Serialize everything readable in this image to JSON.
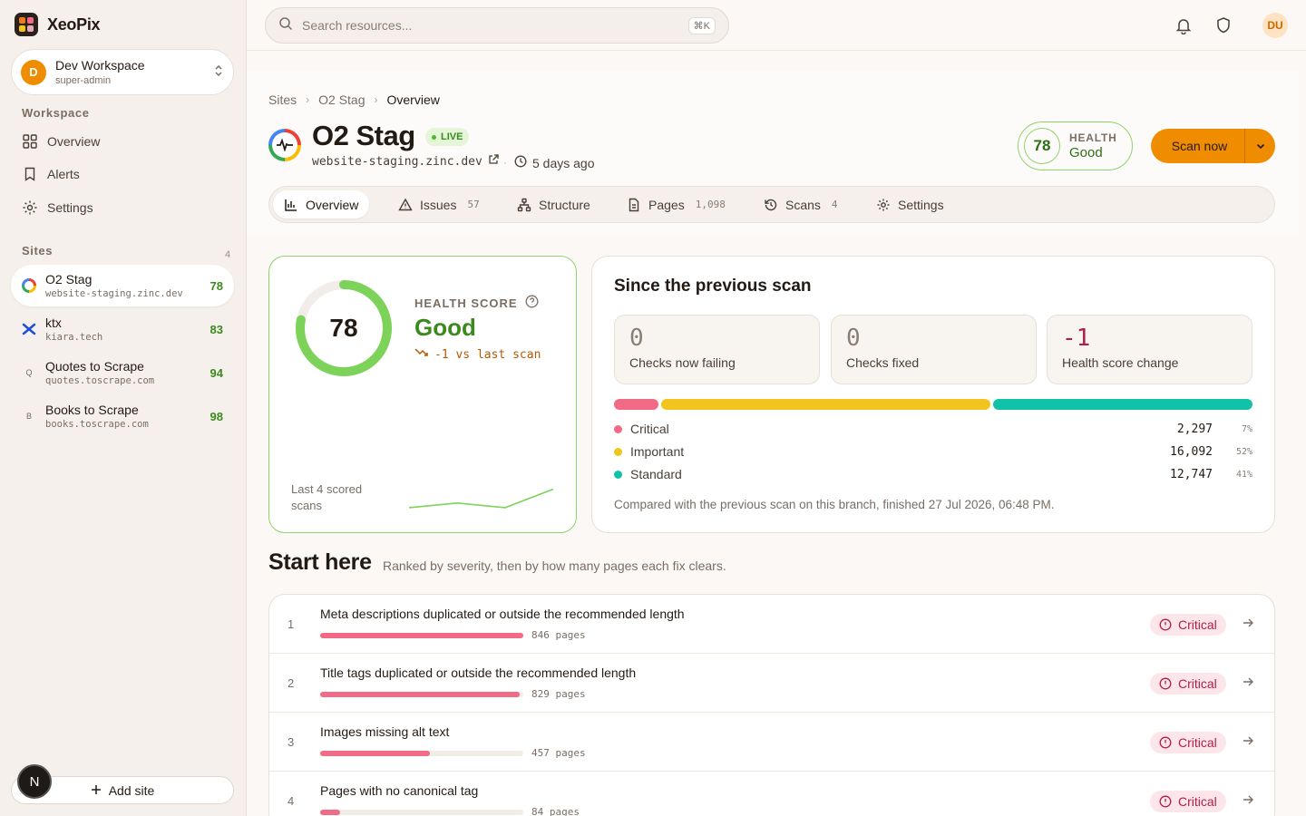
{
  "app": {
    "name": "XeoPix"
  },
  "workspace": {
    "initial": "D",
    "name": "Dev Workspace",
    "role": "super-admin"
  },
  "sidebar": {
    "workspace_title": "Workspace",
    "nav": [
      {
        "label": "Overview"
      },
      {
        "label": "Alerts"
      },
      {
        "label": "Settings"
      }
    ],
    "sites_title": "Sites",
    "sites_count": "4",
    "sites": [
      {
        "name": "O2 Stag",
        "host": "website-staging.zinc.dev",
        "score": "78"
      },
      {
        "name": "ktx",
        "host": "kiara.tech",
        "score": "83"
      },
      {
        "name": "Quotes to Scrape",
        "host": "quotes.toscrape.com",
        "score": "94",
        "initial": "Q"
      },
      {
        "name": "Books to Scrape",
        "host": "books.toscrape.com",
        "score": "98",
        "initial": "B"
      }
    ],
    "add_site": "Add site",
    "badge": "N"
  },
  "topbar": {
    "search_placeholder": "Search resources...",
    "shortcut": "⌘K",
    "user_initials": "DU"
  },
  "breadcrumb": {
    "items": [
      "Sites",
      "O2 Stag",
      "Overview"
    ]
  },
  "site": {
    "title": "O2 Stag",
    "status": "LIVE",
    "url": "website-staging.zinc.dev",
    "last_scan": "5 days ago",
    "health": {
      "score": "78",
      "label": "HEALTH",
      "value": "Good"
    }
  },
  "actions": {
    "scan_now": "Scan now"
  },
  "tabs": [
    {
      "label": "Overview"
    },
    {
      "label": "Issues",
      "count": "57"
    },
    {
      "label": "Structure"
    },
    {
      "label": "Pages",
      "count": "1,098"
    },
    {
      "label": "Scans",
      "count": "4"
    },
    {
      "label": "Settings"
    }
  ],
  "health_card": {
    "label": "HEALTH SCORE",
    "score": "78",
    "score_fraction": 0.78,
    "grade": "Good",
    "delta": "-1 vs last scan",
    "spark_label": "Last 4 scored scans",
    "spark_values": [
      78,
      79,
      78,
      82
    ]
  },
  "since": {
    "title": "Since the previous scan",
    "stats": [
      {
        "value": "0",
        "label": "Checks now failing"
      },
      {
        "value": "0",
        "label": "Checks fixed"
      },
      {
        "value": "-1",
        "label": "Health score change"
      }
    ],
    "breakdown": [
      {
        "name": "Critical",
        "count": "2,297",
        "pct": "7%",
        "color": "#f26b86",
        "share": 7
      },
      {
        "name": "Important",
        "count": "16,092",
        "pct": "52%",
        "color": "#f2c41f",
        "share": 52
      },
      {
        "name": "Standard",
        "count": "12,747",
        "pct": "41%",
        "color": "#12c2a8",
        "share": 41
      }
    ],
    "footnote": "Compared with the previous scan on this branch, finished 27 Jul 2026, 06:48 PM."
  },
  "start": {
    "title": "Start here",
    "subtitle": "Ranked by severity, then by how many pages each fix clears.",
    "issues": [
      {
        "rank": "1",
        "title": "Meta descriptions duplicated or outside the recommended length",
        "pages": "846 pages",
        "severity": "Critical",
        "fraction": 1.0
      },
      {
        "rank": "2",
        "title": "Title tags duplicated or outside the recommended length",
        "pages": "829 pages",
        "severity": "Critical",
        "fraction": 0.98
      },
      {
        "rank": "3",
        "title": "Images missing alt text",
        "pages": "457 pages",
        "severity": "Critical",
        "fraction": 0.54
      },
      {
        "rank": "4",
        "title": "Pages with no canonical tag",
        "pages": "84 pages",
        "severity": "Critical",
        "fraction": 0.1
      }
    ]
  }
}
